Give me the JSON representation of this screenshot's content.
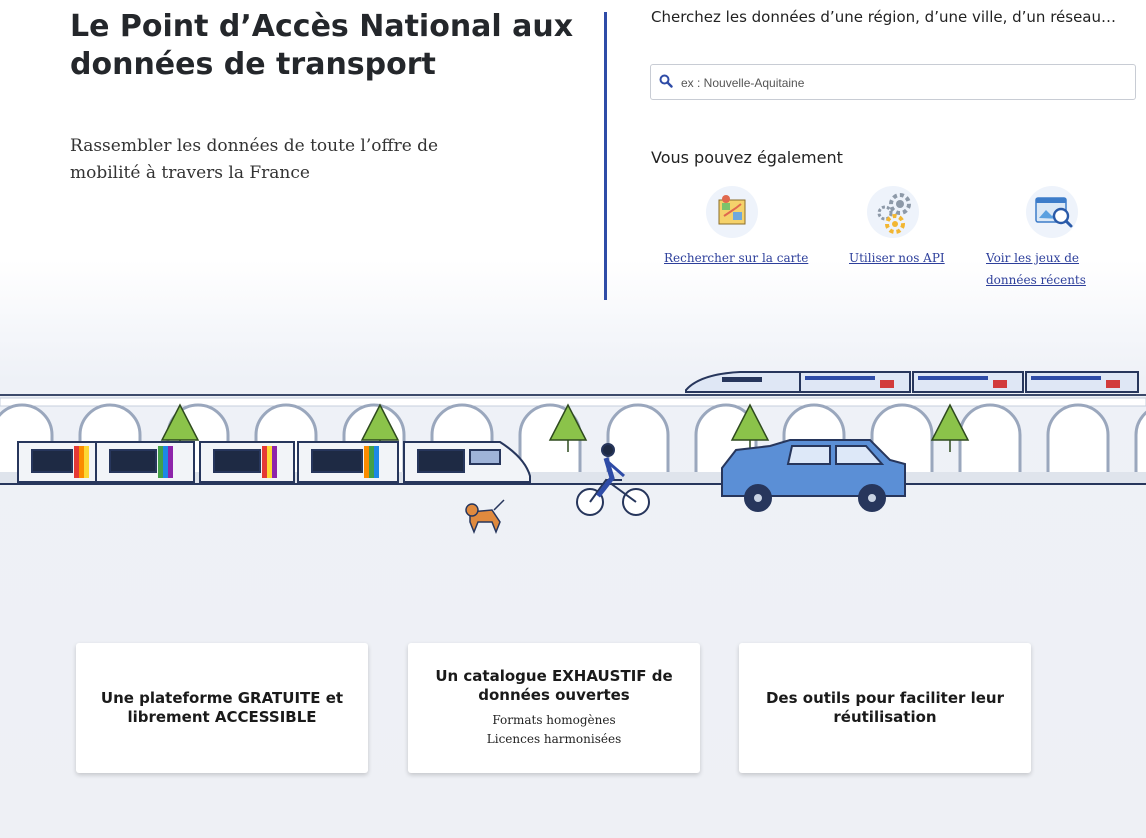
{
  "hero": {
    "title": "Le Point d’Accès National aux données de transport",
    "subtitle": "Rassembler les données de toute l’offre de mobilité à travers la France"
  },
  "search": {
    "label": "Cherchez les données d’une région, d’une ville, d’un réseau…",
    "placeholder": "ex : Nouvelle-Aquitaine",
    "icon": "search-icon"
  },
  "also": {
    "title": "Vous pouvez également",
    "links": [
      {
        "label": "Rechercher sur la carte",
        "icon": "map-icon"
      },
      {
        "label": "Utiliser nos API",
        "icon": "gears-icon"
      },
      {
        "label_line1": "Voir les jeux de",
        "label_line2": "données récents",
        "icon": "dataset-search-icon"
      }
    ]
  },
  "cards": [
    {
      "title": "Une plateforme GRATUITE et librement ACCESSIBLE"
    },
    {
      "title": "Un catalogue EXHAUSTIF de données ouvertes",
      "line1": "Formats homogènes",
      "line2": "Licences harmonisées"
    },
    {
      "title": "Des outils pour faciliter leur réutilisation"
    }
  ],
  "colors": {
    "accent": "#2f4ca7",
    "link": "#2d3f9b",
    "tree": "#8bc34a",
    "car": "#5b8fd6"
  }
}
